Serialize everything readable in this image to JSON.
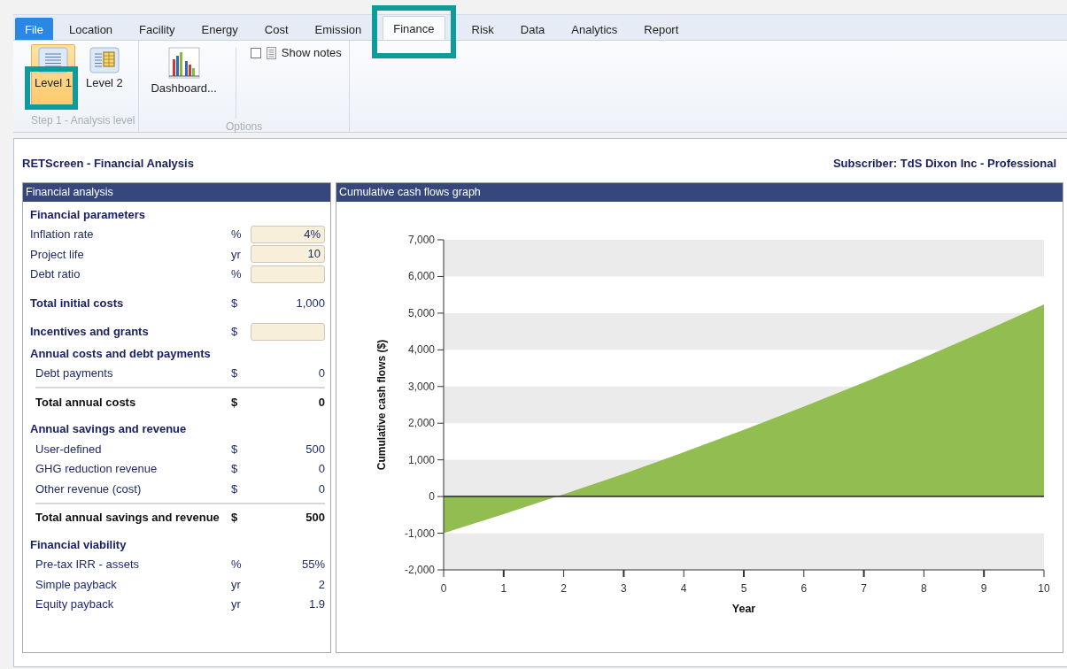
{
  "tabs": [
    {
      "label": "File",
      "kind": "app",
      "selected": false
    },
    {
      "label": "Location",
      "kind": "tab",
      "selected": false
    },
    {
      "label": "Facility",
      "kind": "tab",
      "selected": false
    },
    {
      "label": "Energy",
      "kind": "tab",
      "selected": false
    },
    {
      "label": "Cost",
      "kind": "tab",
      "selected": false
    },
    {
      "label": "Emission",
      "kind": "tab",
      "selected": false
    },
    {
      "label": "Finance",
      "kind": "tab",
      "selected": true
    },
    {
      "label": "Risk",
      "kind": "tab",
      "selected": false
    },
    {
      "label": "Data",
      "kind": "tab",
      "selected": false
    },
    {
      "label": "Analytics",
      "kind": "tab",
      "selected": false
    },
    {
      "label": "Report",
      "kind": "tab",
      "selected": false
    }
  ],
  "ribbon": {
    "levels_group": {
      "label": "Step 1 - Analysis level",
      "buttons": [
        {
          "label": "Level 1",
          "kind": "list",
          "selected": true
        },
        {
          "label": "Level 2",
          "kind": "grid",
          "selected": false
        }
      ]
    },
    "options_group": {
      "label": "Options",
      "dashboard": {
        "label": "Dashboard..."
      },
      "show_notes": {
        "label": "Show notes",
        "checked": false
      }
    }
  },
  "header": {
    "title": "RETScreen - Financial Analysis",
    "subscriber": "Subscriber: TdS Dixon Inc - Professional"
  },
  "analysis": {
    "title": "Financial analysis",
    "rows": [
      {
        "kind": "section",
        "label": "Financial parameters"
      },
      {
        "kind": "input",
        "label": "Inflation rate",
        "unit": "%",
        "value": "4%"
      },
      {
        "kind": "input",
        "label": "Project life",
        "unit": "yr",
        "value": "10"
      },
      {
        "kind": "input",
        "label": "Debt ratio",
        "unit": "%"
      },
      {
        "kind": "key",
        "label": "Total initial costs",
        "unit": "$",
        "value": "1,000"
      },
      {
        "kind": "key-input",
        "label": "Incentives and grants",
        "unit": "$"
      },
      {
        "kind": "section",
        "label": "Annual costs and debt payments"
      },
      {
        "kind": "item",
        "label": "Debt payments",
        "unit": "$",
        "value": "0"
      },
      {
        "kind": "total",
        "label": "Total annual costs",
        "unit": "$",
        "value": "0"
      },
      {
        "kind": "section",
        "label": "Annual savings and revenue"
      },
      {
        "kind": "item",
        "label": "User-defined",
        "unit": "$",
        "value": "500"
      },
      {
        "kind": "item",
        "label": "GHG reduction revenue",
        "unit": "$",
        "value": "0"
      },
      {
        "kind": "item",
        "label": "Other revenue (cost)",
        "unit": "$",
        "value": "0"
      },
      {
        "kind": "total",
        "label": "Total annual savings and revenue",
        "unit": "$",
        "value": "500"
      },
      {
        "kind": "section",
        "label": "Financial viability"
      },
      {
        "kind": "item",
        "label": "Pre-tax IRR - assets",
        "unit": "%",
        "value": "55%"
      },
      {
        "kind": "item",
        "label": "Simple payback",
        "unit": "yr",
        "value": "2"
      },
      {
        "kind": "item",
        "label": "Equity payback",
        "unit": "yr",
        "value": "1.9"
      }
    ]
  },
  "graph": {
    "title": "Cumulative cash flows graph",
    "chart_data": {
      "type": "area",
      "xlabel": "Year",
      "ylabel": "Cumulative cash flows ($)",
      "x": [
        0,
        1,
        2,
        3,
        4,
        5,
        6,
        7,
        8,
        9,
        10
      ],
      "series": [
        {
          "color": "#92bd50",
          "values": [
            -1000,
            -480,
            60,
            620,
            1210,
            1820,
            2450,
            3110,
            3790,
            4500,
            5240
          ]
        }
      ],
      "xlim": [
        0,
        10
      ],
      "ylim": [
        -2000,
        7000
      ],
      "xticks": [
        0,
        1,
        2,
        3,
        4,
        5,
        6,
        7,
        8,
        9,
        10
      ],
      "yticks": [
        {
          "value": -2000,
          "label": "-2,000"
        },
        {
          "value": -1000,
          "label": "-1,000"
        },
        {
          "value": 0,
          "label": "0"
        },
        {
          "value": 1000,
          "label": "1,000"
        },
        {
          "value": 2000,
          "label": "2,000"
        },
        {
          "value": 3000,
          "label": "3,000"
        },
        {
          "value": 4000,
          "label": "4,000"
        },
        {
          "value": 5000,
          "label": "5,000"
        },
        {
          "value": 6000,
          "label": "6,000"
        },
        {
          "value": 7000,
          "label": "7,000"
        }
      ]
    }
  }
}
